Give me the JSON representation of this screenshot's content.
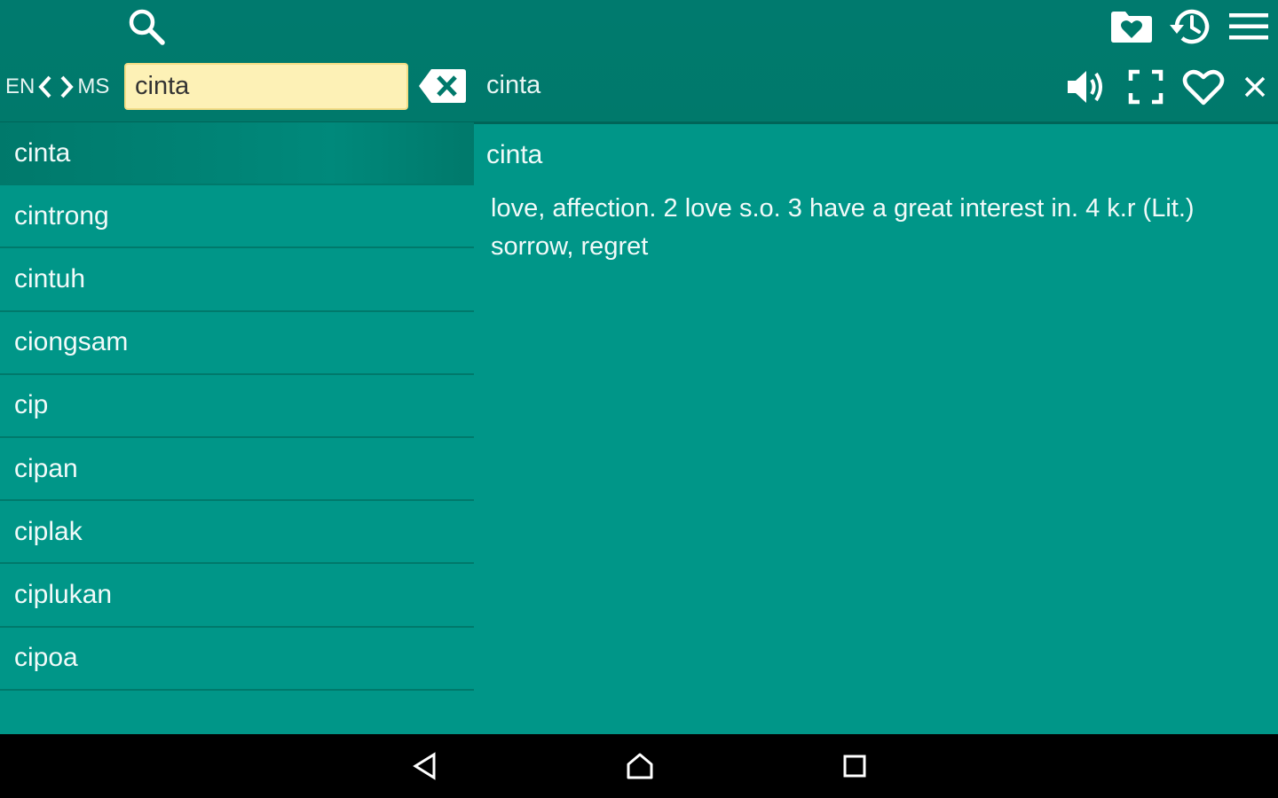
{
  "header": {
    "search_icon": "search-icon",
    "favorites_folder_icon": "heart-folder-icon",
    "history_icon": "history-icon",
    "menu_icon": "hamburger-menu-icon",
    "source_lang": "EN",
    "target_lang": "MS",
    "search": {
      "value": "cinta",
      "placeholder": ""
    },
    "clear_icon": "backspace-clear-icon",
    "current_word": "cinta",
    "speaker_icon": "speaker-icon",
    "fullscreen_icon": "fullscreen-icon",
    "favorite_icon": "heart-outline-icon",
    "close_icon": "close-icon"
  },
  "word_list": {
    "items": [
      {
        "label": "cinta",
        "selected": true
      },
      {
        "label": "cintrong"
      },
      {
        "label": "cintuh"
      },
      {
        "label": "ciongsam"
      },
      {
        "label": "cip"
      },
      {
        "label": "cipan"
      },
      {
        "label": "ciplak"
      },
      {
        "label": "ciplukan"
      },
      {
        "label": "cipoa"
      }
    ]
  },
  "definition": {
    "word": "cinta",
    "text": "love, affection. 2 love s.o. 3 have a great interest in. 4 k.r (Lit.) sorrow, regret"
  },
  "navbar": {
    "back_icon": "back-triangle-icon",
    "home_icon": "home-icon",
    "recents_icon": "recents-square-icon"
  },
  "colors": {
    "primary": "#009688",
    "primary_dark": "#00796b",
    "search_bg": "#fdf1b6",
    "nav_bg": "#000000"
  }
}
